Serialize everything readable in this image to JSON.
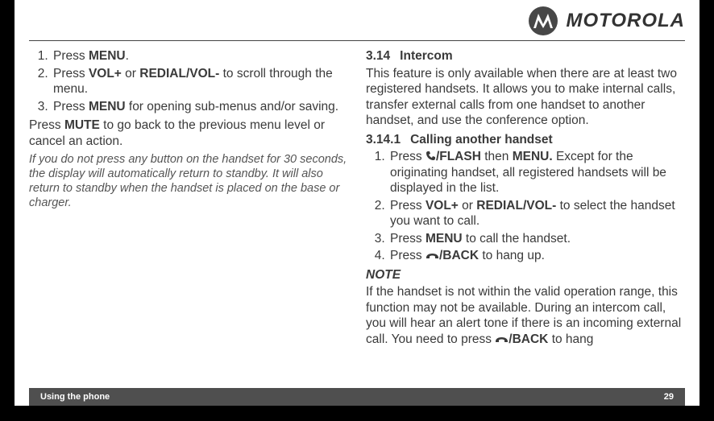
{
  "brand": {
    "wordmark": "MOTOROLA"
  },
  "left": {
    "steps": [
      {
        "pre": "Press ",
        "bold": "MENU",
        "post": "."
      },
      {
        "pre": "Press ",
        "bold": "VOL+",
        "mid": " or ",
        "bold2": "REDIAL/VOL-",
        "post": " to scroll through the menu."
      },
      {
        "pre": "Press ",
        "bold": "MENU",
        "post": " for opening sub-menus and/or saving."
      }
    ],
    "mute": {
      "pre": "Press ",
      "bold": "MUTE",
      "post": " to go back to the previous menu level or cancel an action."
    },
    "italic": "If you do not press any button on the handset for 30 seconds, the display will automatically return to standby. It will also return to standby when the handset is placed on the base or charger."
  },
  "right": {
    "section": {
      "num": "3.14",
      "title": "Intercom"
    },
    "intro": "This feature is only available when there are at least two registered handsets. It allows you to make internal calls, transfer external calls from one handset to another handset, and use the conference option.",
    "sub": {
      "num": "3.14.1",
      "title": "Calling another handset"
    },
    "steps": [
      {
        "pre": "Press ",
        "icon": "phone",
        "bold": "/FLASH",
        "mid": " then ",
        "bold2": "MENU.",
        "post": " Except for the originating handset, all registered handsets will be displayed in the list."
      },
      {
        "pre": "Press ",
        "bold": "VOL+",
        "mid": " or ",
        "bold2": "REDIAL/VOL-",
        "post": " to select the handset you want to call."
      },
      {
        "pre": "Press ",
        "bold": "MENU",
        "post": " to call the handset."
      },
      {
        "pre": "Press ",
        "icon": "hang",
        "bold": "/BACK",
        "post": " to hang up."
      }
    ],
    "note_h": "NOTE",
    "note": {
      "pre": "If the handset is not within the valid operation range, this function may not be available. During an intercom call, you will hear an alert tone if there is an incoming external call. You need to press ",
      "icon": "hang",
      "bold": "/BACK",
      "post": " to hang"
    }
  },
  "footer": {
    "left": "Using the phone",
    "right": "29"
  }
}
